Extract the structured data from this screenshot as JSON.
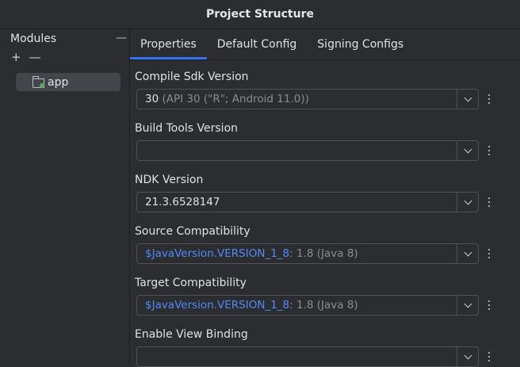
{
  "window": {
    "title": "Project Structure"
  },
  "modules": {
    "header": "Modules",
    "add_symbol": "+",
    "remove_symbol": "—",
    "collapse_symbol": "—",
    "items": [
      {
        "label": "app",
        "icon": "module-folder-icon"
      }
    ]
  },
  "tabs": [
    {
      "label": "Properties",
      "active": true
    },
    {
      "label": "Default Config",
      "active": false
    },
    {
      "label": "Signing Configs",
      "active": false
    }
  ],
  "fields": {
    "compile_sdk": {
      "label": "Compile Sdk Version",
      "value": "30",
      "hint": "(API 30 (\"R\"; Android 11.0))"
    },
    "build_tools": {
      "label": "Build Tools Version",
      "value": ""
    },
    "ndk": {
      "label": "NDK Version",
      "value": "21.3.6528147"
    },
    "source_compat": {
      "label": "Source Compatibility",
      "value": "$JavaVersion.VERSION_1_8",
      "hint": " : 1.8 (Java 8)"
    },
    "target_compat": {
      "label": "Target Compatibility",
      "value": "$JavaVersion.VERSION_1_8",
      "hint": " : 1.8 (Java 8)"
    },
    "view_binding": {
      "label": "Enable View Binding",
      "value": ""
    }
  },
  "colors": {
    "accent": "#3574f0",
    "link": "#548af7",
    "background": "#2b2d30"
  }
}
